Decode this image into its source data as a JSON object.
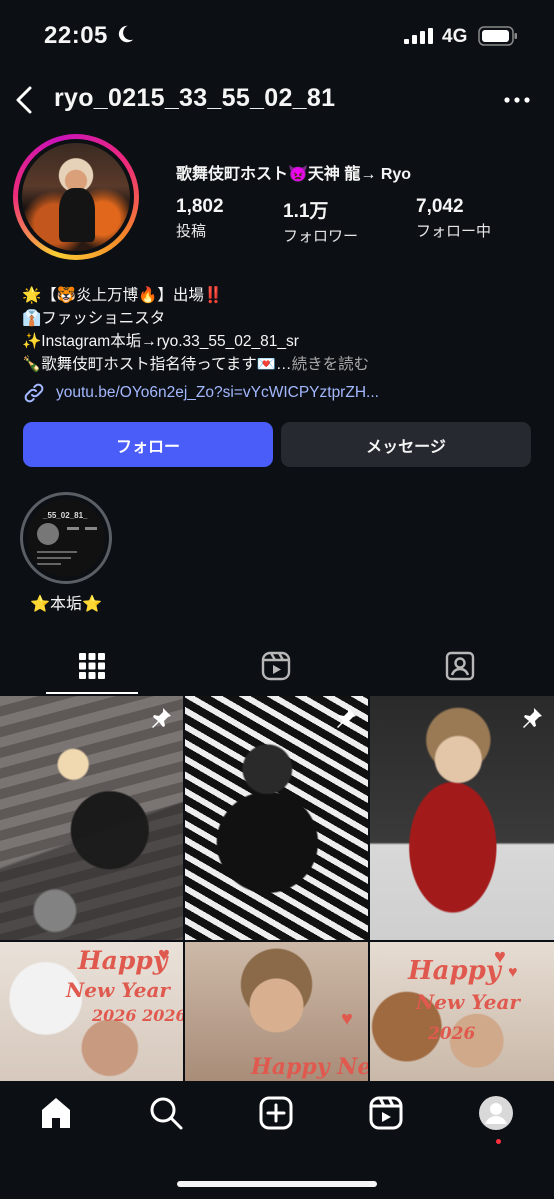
{
  "status_bar": {
    "time": "22:05",
    "network": "4G"
  },
  "header": {
    "username": "ryo_0215_33_55_02_81"
  },
  "profile": {
    "display_name": "歌舞伎町ホスト👿天神 龍→ Ryo",
    "stats": [
      {
        "value": "1,802",
        "label": "投稿"
      },
      {
        "value": "1.1万",
        "label": "フォロワー"
      },
      {
        "value": "7,042",
        "label": "フォロー中"
      }
    ],
    "bio_lines": [
      "🌟【🐯炎上万博🔥】出場‼️",
      "👔ファッショニスタ",
      "✨Instagram本垢→ryo.33_55_02_81_sr",
      "🍾歌舞伎町ホスト指名待ってます💌…"
    ],
    "bio_more": "続きを読む",
    "link": "youtu.be/OYo6n2ej_Zo?si=vYcWICPYztprZH..."
  },
  "actions": {
    "follow": "フォロー",
    "message": "メッセージ"
  },
  "highlights": [
    {
      "label": "⭐️本垢⭐️",
      "preview_title": "_55_02_81_"
    }
  ],
  "tabs": [
    {
      "name": "posts",
      "icon": "grid-icon",
      "active": true
    },
    {
      "name": "reels",
      "icon": "reels-icon",
      "active": false
    },
    {
      "name": "tagged",
      "icon": "tagged-icon",
      "active": false
    }
  ],
  "posts": [
    {
      "pinned": true
    },
    {
      "pinned": true
    },
    {
      "pinned": true
    },
    {
      "pinned": false,
      "text_lines": [
        "Happy",
        "New Year",
        "2026 2026"
      ]
    },
    {
      "pinned": false,
      "text_lines": [
        "Happy New"
      ]
    },
    {
      "pinned": false,
      "text_lines": [
        "Happy",
        "New Year",
        "2026"
      ]
    }
  ],
  "bottom_nav": [
    "home-icon",
    "search-icon",
    "create-icon",
    "reels-icon",
    "profile-avatar"
  ],
  "colors": {
    "background": "#0c1014",
    "follow_button": "#4a5df9",
    "message_button": "#262a30",
    "link": "#a4b8ff",
    "notification_dot": "#ff3040"
  }
}
